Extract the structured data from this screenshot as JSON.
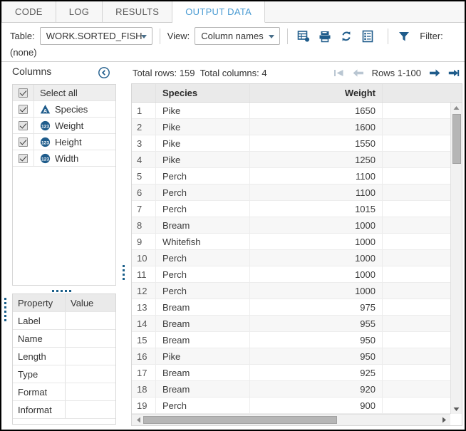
{
  "tabs": [
    {
      "label": "CODE",
      "active": false
    },
    {
      "label": "LOG",
      "active": false
    },
    {
      "label": "RESULTS",
      "active": false
    },
    {
      "label": "OUTPUT DATA",
      "active": true
    }
  ],
  "toolbar": {
    "table_label": "Table:",
    "table_value": "WORK.SORTED_FISH",
    "view_label": "View:",
    "view_value": "Column names",
    "filter_label": "Filter:",
    "filter_value": "(none)",
    "icons": [
      "table-properties-icon",
      "save-data-icon",
      "refresh-icon",
      "column-details-icon",
      "filter-funnel-icon"
    ]
  },
  "columns_panel": {
    "title": "Columns",
    "collapse_icon": "collapse-left-icon",
    "select_all_label": "Select all",
    "items": [
      {
        "label": "Species",
        "type_icon": "character-type-icon",
        "checked": true
      },
      {
        "label": "Weight",
        "type_icon": "numeric-type-icon",
        "checked": true
      },
      {
        "label": "Height",
        "type_icon": "numeric-type-icon",
        "checked": true
      },
      {
        "label": "Width",
        "type_icon": "numeric-type-icon",
        "checked": true
      }
    ]
  },
  "properties_panel": {
    "header": {
      "property": "Property",
      "value": "Value"
    },
    "rows": [
      {
        "property": "Label",
        "value": ""
      },
      {
        "property": "Name",
        "value": ""
      },
      {
        "property": "Length",
        "value": ""
      },
      {
        "property": "Type",
        "value": ""
      },
      {
        "property": "Format",
        "value": ""
      },
      {
        "property": "Informat",
        "value": ""
      }
    ]
  },
  "grid": {
    "total_rows_text": "Total rows: 159",
    "total_columns_text": "Total columns: 4",
    "rows_range": "Rows 1-100",
    "nav": {
      "first": "go-to-first-page-icon",
      "prev": "go-to-previous-page-icon",
      "next": "go-to-next-page-icon",
      "last": "go-to-last-page-icon"
    },
    "headers": {
      "rownum": "",
      "species": "Species",
      "weight": "Weight",
      "blank": ""
    },
    "rows": [
      {
        "n": "1",
        "species": "Pike",
        "weight": "1650"
      },
      {
        "n": "2",
        "species": "Pike",
        "weight": "1600"
      },
      {
        "n": "3",
        "species": "Pike",
        "weight": "1550"
      },
      {
        "n": "4",
        "species": "Pike",
        "weight": "1250"
      },
      {
        "n": "5",
        "species": "Perch",
        "weight": "1100"
      },
      {
        "n": "6",
        "species": "Perch",
        "weight": "1100"
      },
      {
        "n": "7",
        "species": "Perch",
        "weight": "1015"
      },
      {
        "n": "8",
        "species": "Bream",
        "weight": "1000"
      },
      {
        "n": "9",
        "species": "Whitefish",
        "weight": "1000"
      },
      {
        "n": "10",
        "species": "Perch",
        "weight": "1000"
      },
      {
        "n": "11",
        "species": "Perch",
        "weight": "1000"
      },
      {
        "n": "12",
        "species": "Perch",
        "weight": "1000"
      },
      {
        "n": "13",
        "species": "Bream",
        "weight": "975"
      },
      {
        "n": "14",
        "species": "Bream",
        "weight": "955"
      },
      {
        "n": "15",
        "species": "Bream",
        "weight": "950"
      },
      {
        "n": "16",
        "species": "Pike",
        "weight": "950"
      },
      {
        "n": "17",
        "species": "Bream",
        "weight": "925"
      },
      {
        "n": "18",
        "species": "Bream",
        "weight": "920"
      },
      {
        "n": "19",
        "species": "Perch",
        "weight": "900"
      }
    ]
  },
  "colors": {
    "accent_blue": "#1f5c8b",
    "active_tab_text": "#4b9cd3",
    "header_bg": "#eaeaea",
    "scroll_thumb": "#b6b6b6"
  }
}
